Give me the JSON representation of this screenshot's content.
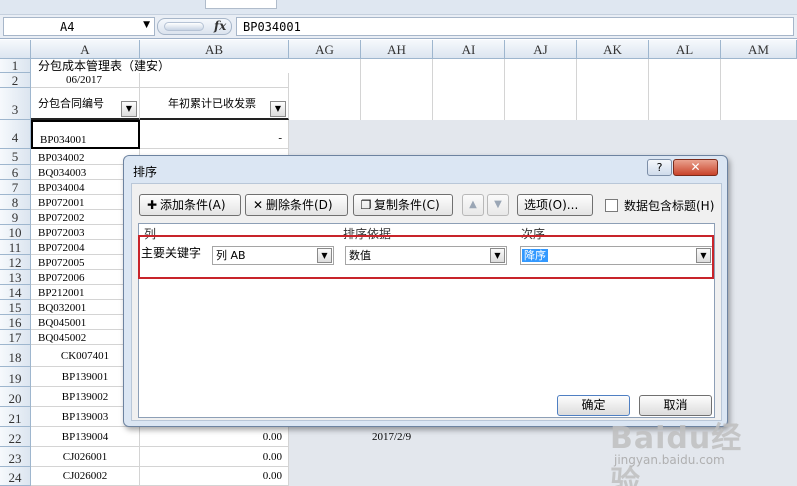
{
  "formula_bar": {
    "name_box": "A4",
    "fx_label": "fx",
    "content": "BP034001"
  },
  "columns": [
    "A",
    "AB",
    "AG",
    "AH",
    "AI",
    "AJ",
    "AK",
    "AL",
    "AM"
  ],
  "rows": {
    "numbers": [
      "1",
      "2",
      "3",
      "4",
      "5",
      "6",
      "7",
      "8",
      "9",
      "10",
      "11",
      "12",
      "13",
      "14",
      "15",
      "16",
      "17",
      "18",
      "19",
      "20",
      "21",
      "22",
      "23",
      "24"
    ]
  },
  "sheet": {
    "title": "分包成本管理表（建安）",
    "date": "06/2017",
    "header_a": "分包合同编号",
    "header_ab": "年初累计已收发票",
    "row4_a": "BP034001",
    "row4_ab": "-",
    "col_a_values": [
      "BP034002",
      "BQ034003",
      "BP034004",
      "BP072001",
      "BP072002",
      "BP072003",
      "BP072004",
      "BP072005",
      "BP072006",
      "BP212001",
      "BQ032001",
      "BQ045001",
      "BQ045002",
      "CK007401",
      "BP139001",
      "BP139002",
      "BP139003",
      "BP139004",
      "CJ026001",
      "CJ026002"
    ],
    "row22_ab": "0.00",
    "row22_ah": "2017/2/9",
    "row23_ab": "0.00",
    "row24_ab": "0.00"
  },
  "dialog": {
    "title": "排序",
    "help": "?",
    "close": "✕",
    "add_condition": "添加条件(A)",
    "delete_condition": "删除条件(D)",
    "copy_condition": "复制条件(C)",
    "options": "选项(O)...",
    "header_checkbox_label": "数据包含标题(H)",
    "col_header_column": "列",
    "col_header_sort_on": "排序依据",
    "col_header_order": "次序",
    "primary_key_label": "主要关键字",
    "column_value": "列 AB",
    "sort_on_value": "数值",
    "order_value": "降序",
    "ok": "确定",
    "cancel": "取消"
  },
  "watermark": {
    "big": "Baidu经验",
    "small": "jingyan.baidu.com"
  }
}
